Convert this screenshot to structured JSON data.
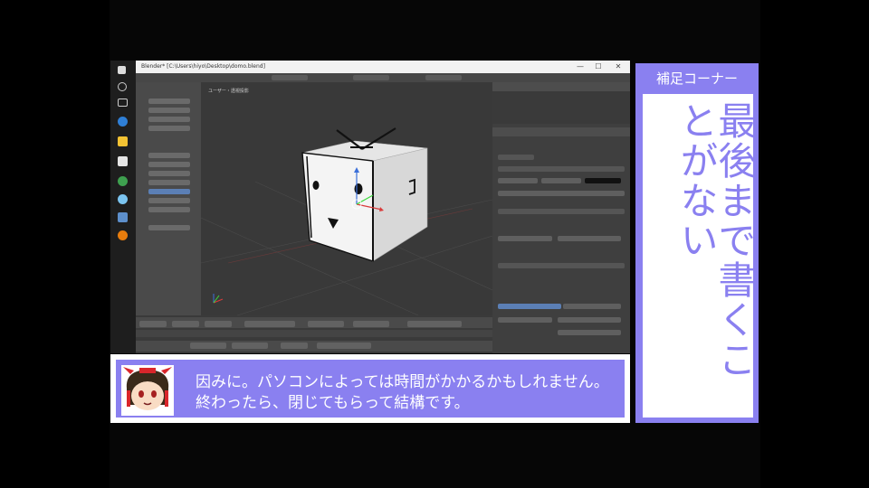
{
  "window": {
    "title": "Blender* [C:\\Users\\hiyo\\Desktop\\domo.blend]",
    "minimize": "—",
    "maximize": "☐",
    "close": "✕"
  },
  "viewport": {
    "label": "ユーザー・透視投影"
  },
  "side_panel": {
    "header": "補足コーナー",
    "main_text": "最後まで書くことがない"
  },
  "subtitle": {
    "line1": "因みに。パソコンによっては時間がかかるかもしれません。",
    "line2": "終わったら、閉じてもらって結構です。"
  },
  "colors": {
    "accent": "#8a80f0",
    "background": "#000000"
  }
}
